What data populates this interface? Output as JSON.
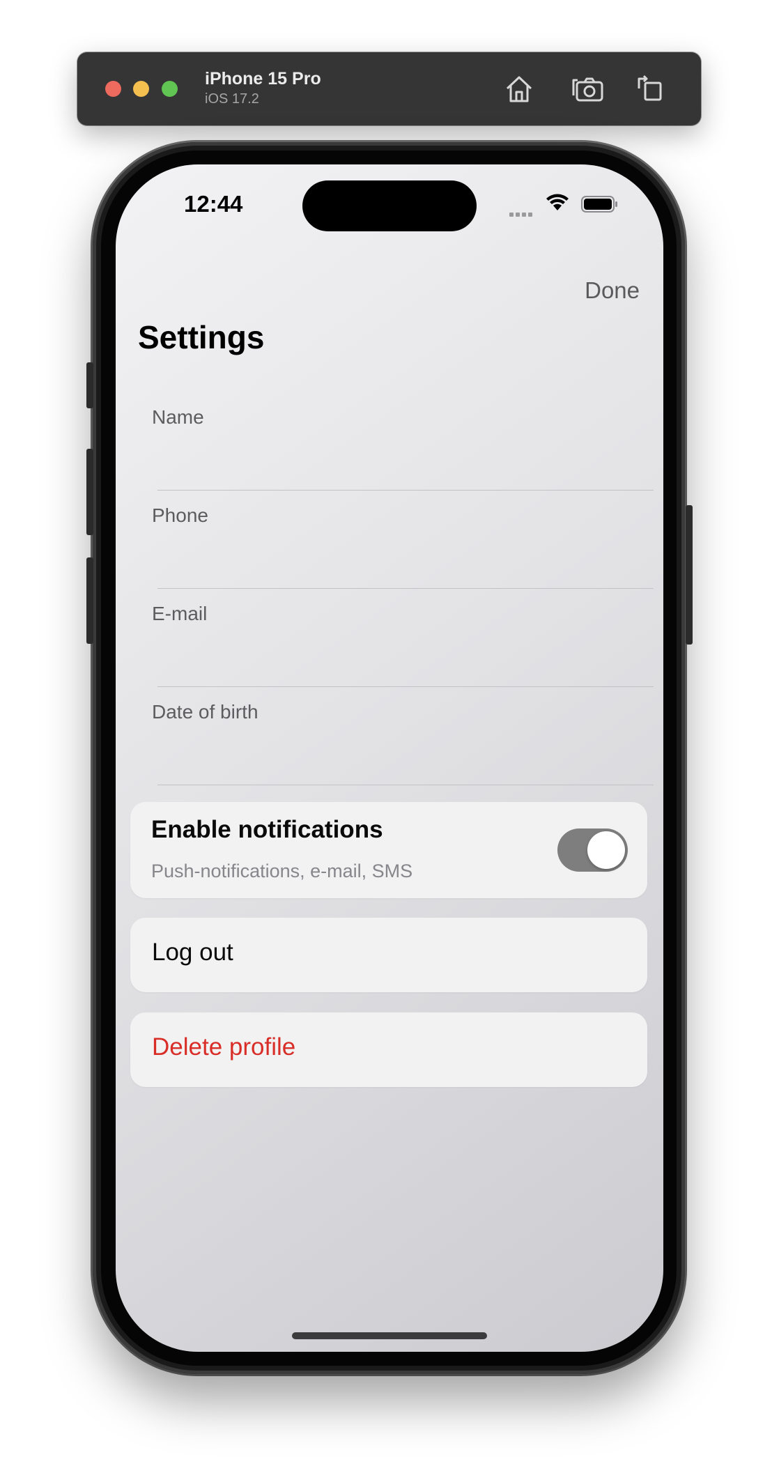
{
  "toolbar": {
    "device_name": "iPhone 15 Pro",
    "os_version": "iOS 17.2",
    "traffic_light_colors": [
      "#ed6a5e",
      "#f5bf4f",
      "#61c554"
    ],
    "buttons": [
      "home-icon",
      "screenshot-icon",
      "rotate-icon"
    ]
  },
  "status_bar": {
    "time": "12:44",
    "icons": [
      "cellular-signal-icon",
      "wifi-icon",
      "battery-icon"
    ]
  },
  "nav": {
    "done_label": "Done",
    "title": "Settings"
  },
  "form": {
    "fields": [
      {
        "label": "Name",
        "value": ""
      },
      {
        "label": "Phone",
        "value": ""
      },
      {
        "label": "E-mail",
        "value": ""
      },
      {
        "label": "Date of birth",
        "value": ""
      }
    ]
  },
  "notifications": {
    "title": "Enable notifications",
    "subtitle": "Push-notifications, e-mail, SMS",
    "enabled": true
  },
  "actions": {
    "logout_label": "Log out",
    "delete_label": "Delete profile",
    "delete_color": "#d92e28"
  }
}
